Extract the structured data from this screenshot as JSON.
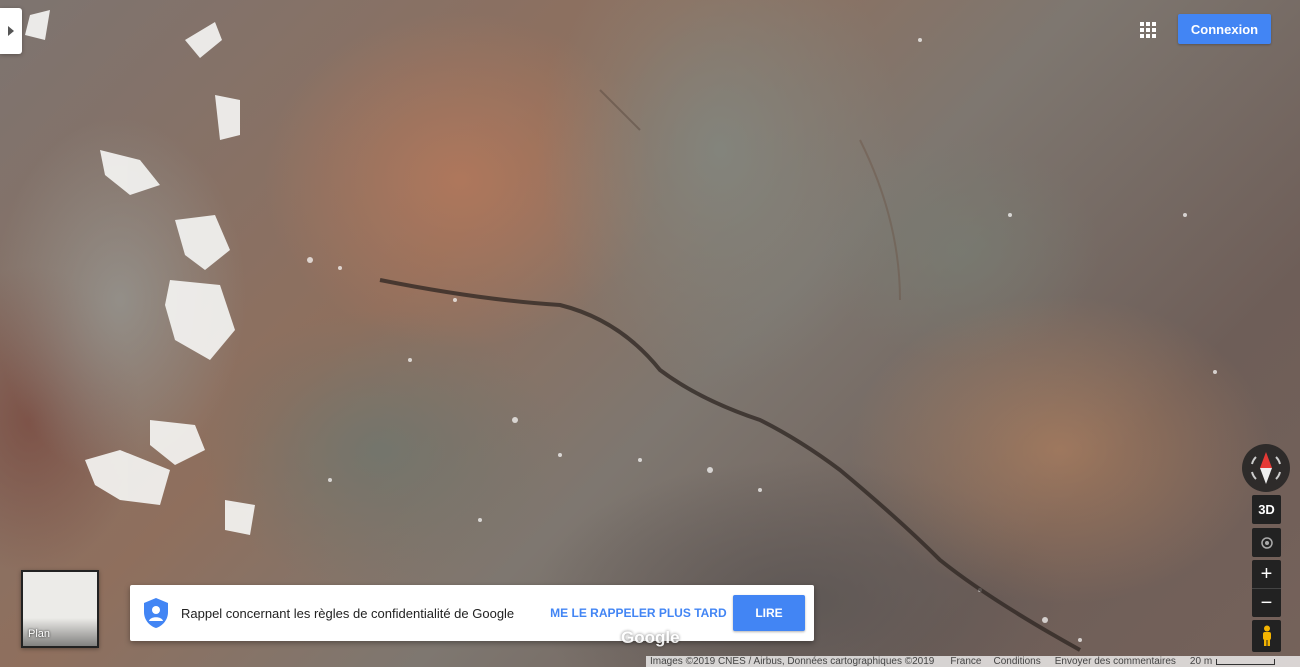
{
  "header": {
    "apps_icon": "apps-grid-icon",
    "login_label": "Connexion"
  },
  "sidebar_toggle": {
    "icon": "chevron-right-icon"
  },
  "map": {
    "type": "satellite",
    "controls": {
      "compass_icon": "compass-icon",
      "three_d_label": "3D",
      "locate_icon": "my-location-icon",
      "zoom_in_label": "+",
      "zoom_out_label": "−",
      "pegman_icon": "pegman-icon"
    },
    "layer_switcher": {
      "label": "Plan"
    },
    "logo_text": "Google"
  },
  "privacy_banner": {
    "icon": "shield-account-icon",
    "message": "Rappel concernant les règles de confidentialité de Google",
    "later_label": "ME LE RAPPELER PLUS TARD",
    "read_label": "LIRE"
  },
  "footer": {
    "attribution": "Images ©2019 CNES / Airbus, Données cartographiques ©2019",
    "country": "France",
    "conditions": "Conditions",
    "feedback": "Envoyer des commentaires",
    "scale_label": "20 m"
  },
  "colors": {
    "accent_blue": "#4285f4",
    "control_dark": "#222222",
    "compass_red": "#e53935"
  }
}
